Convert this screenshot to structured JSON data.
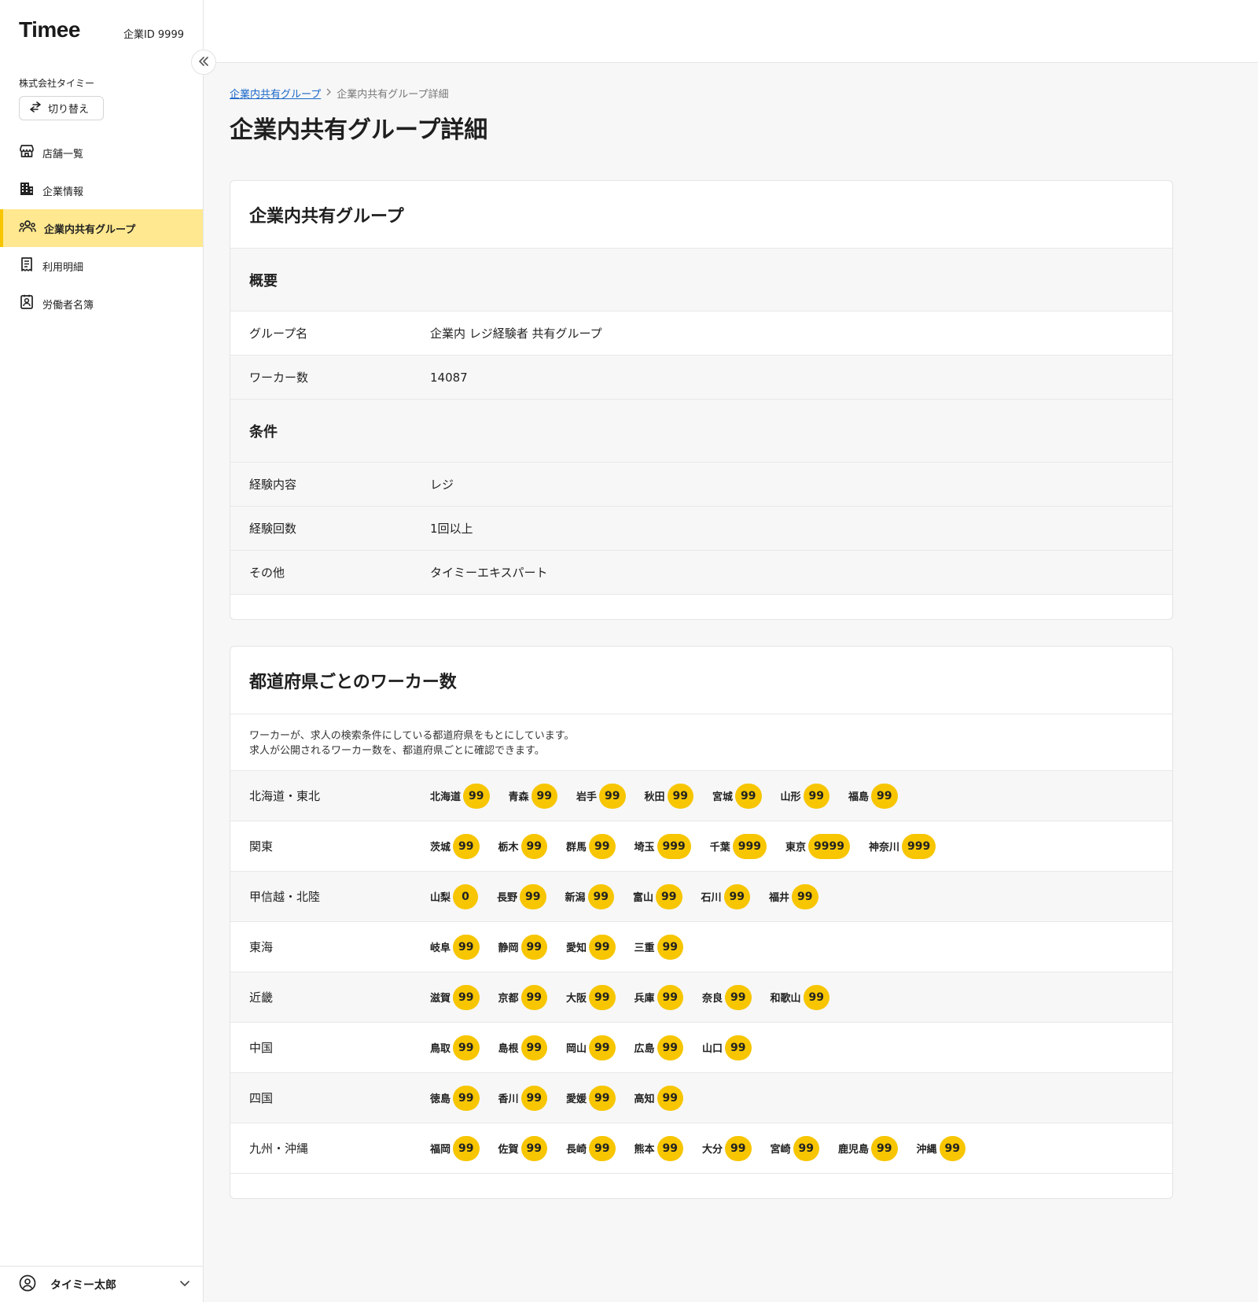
{
  "sidebar": {
    "logo": "Timee",
    "company_id": "企業ID 9999",
    "company_name": "株式会社タイミー",
    "switch_label": "切り替え",
    "items": [
      {
        "label": "店舗一覧",
        "icon": "store-icon"
      },
      {
        "label": "企業情報",
        "icon": "building-icon"
      },
      {
        "label": "企業内共有グループ",
        "icon": "group-icon",
        "active": true
      },
      {
        "label": "利用明細",
        "icon": "receipt-icon"
      },
      {
        "label": "労働者名簿",
        "icon": "contact-book-icon"
      }
    ],
    "user_name": "タイミー太郎"
  },
  "breadcrumb": {
    "parent": "企業内共有グループ",
    "current": "企業内共有グループ詳細"
  },
  "page_title": "企業内共有グループ詳細",
  "group_card": {
    "title": "企業内共有グループ",
    "overview": {
      "heading": "概要",
      "rows": [
        {
          "label": "グループ名",
          "value": "企業内 レジ経験者 共有グループ"
        },
        {
          "label": "ワーカー数",
          "value": "14087"
        }
      ]
    },
    "conditions": {
      "heading": "条件",
      "rows": [
        {
          "label": "経験内容",
          "value": "レジ"
        },
        {
          "label": "経験回数",
          "value": "1回以上"
        },
        {
          "label": "その他",
          "value": "タイミーエキスパート"
        }
      ]
    }
  },
  "prefecture_card": {
    "title": "都道府県ごとのワーカー数",
    "description_line1": "ワーカーが、求人の検索条件にしている都道府県をもとにしています。",
    "description_line2": "求人が公開されるワーカー数を、都道府県ごとに確認できます。",
    "regions": [
      {
        "name": "北海道・東北",
        "prefs": [
          {
            "name": "北海道",
            "count": "99"
          },
          {
            "name": "青森",
            "count": "99"
          },
          {
            "name": "岩手",
            "count": "99"
          },
          {
            "name": "秋田",
            "count": "99"
          },
          {
            "name": "宮城",
            "count": "99"
          },
          {
            "name": "山形",
            "count": "99"
          },
          {
            "name": "福島",
            "count": "99"
          }
        ]
      },
      {
        "name": "関東",
        "prefs": [
          {
            "name": "茨城",
            "count": "99"
          },
          {
            "name": "栃木",
            "count": "99"
          },
          {
            "name": "群馬",
            "count": "99"
          },
          {
            "name": "埼玉",
            "count": "999"
          },
          {
            "name": "千葉",
            "count": "999"
          },
          {
            "name": "東京",
            "count": "9999"
          },
          {
            "name": "神奈川",
            "count": "999"
          }
        ]
      },
      {
        "name": "甲信越・北陸",
        "prefs": [
          {
            "name": "山梨",
            "count": "0"
          },
          {
            "name": "長野",
            "count": "99"
          },
          {
            "name": "新潟",
            "count": "99"
          },
          {
            "name": "富山",
            "count": "99"
          },
          {
            "name": "石川",
            "count": "99"
          },
          {
            "name": "福井",
            "count": "99"
          }
        ]
      },
      {
        "name": "東海",
        "prefs": [
          {
            "name": "岐阜",
            "count": "99"
          },
          {
            "name": "静岡",
            "count": "99"
          },
          {
            "name": "愛知",
            "count": "99"
          },
          {
            "name": "三重",
            "count": "99"
          }
        ]
      },
      {
        "name": "近畿",
        "prefs": [
          {
            "name": "滋賀",
            "count": "99"
          },
          {
            "name": "京都",
            "count": "99"
          },
          {
            "name": "大阪",
            "count": "99"
          },
          {
            "name": "兵庫",
            "count": "99"
          },
          {
            "name": "奈良",
            "count": "99"
          },
          {
            "name": "和歌山",
            "count": "99"
          }
        ]
      },
      {
        "name": "中国",
        "prefs": [
          {
            "name": "鳥取",
            "count": "99"
          },
          {
            "name": "島根",
            "count": "99"
          },
          {
            "name": "岡山",
            "count": "99"
          },
          {
            "name": "広島",
            "count": "99"
          },
          {
            "name": "山口",
            "count": "99"
          }
        ]
      },
      {
        "name": "四国",
        "prefs": [
          {
            "name": "徳島",
            "count": "99"
          },
          {
            "name": "香川",
            "count": "99"
          },
          {
            "name": "愛媛",
            "count": "99"
          },
          {
            "name": "高知",
            "count": "99"
          }
        ]
      },
      {
        "name": "九州・沖縄",
        "prefs": [
          {
            "name": "福岡",
            "count": "99"
          },
          {
            "name": "佐賀",
            "count": "99"
          },
          {
            "name": "長崎",
            "count": "99"
          },
          {
            "name": "熊本",
            "count": "99"
          },
          {
            "name": "大分",
            "count": "99"
          },
          {
            "name": "宮崎",
            "count": "99"
          },
          {
            "name": "鹿児島",
            "count": "99"
          },
          {
            "name": "沖縄",
            "count": "99"
          }
        ]
      }
    ]
  },
  "colors": {
    "accent": "#f7c600",
    "active_nav_bg": "#ffe88f",
    "link": "#1a67c9"
  }
}
